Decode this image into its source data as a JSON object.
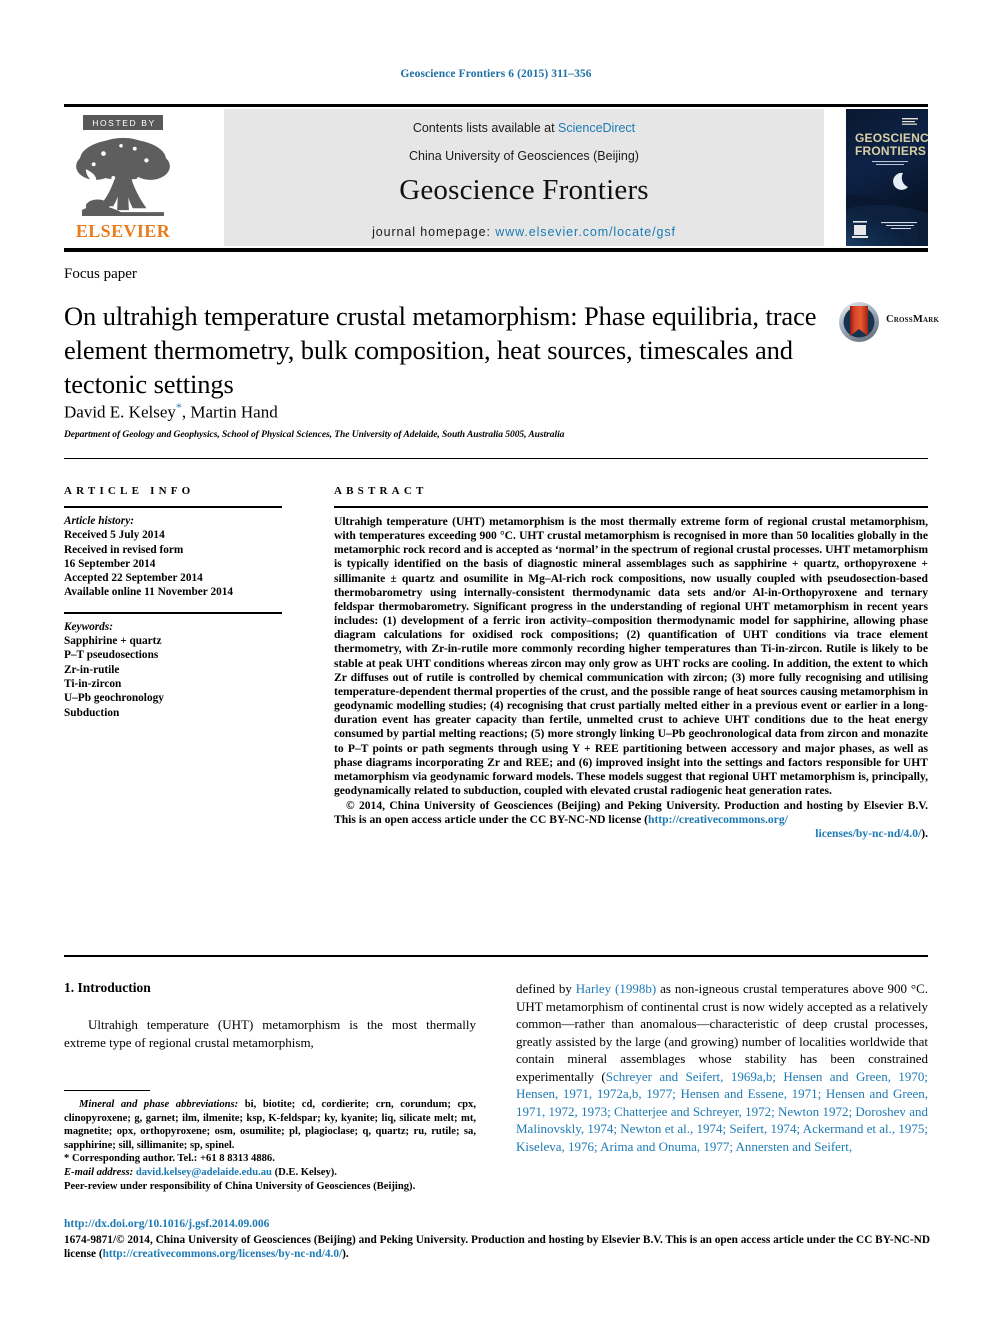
{
  "running_head": "Geoscience Frontiers 6 (2015) 311–356",
  "masthead": {
    "hosted_by": "HOSTED BY",
    "publisher_word": "ELSEVIER",
    "contents_prefix": "Contents lists available at ",
    "contents_link": "ScienceDirect",
    "society": "China University of Geosciences (Beijing)",
    "journal_title": "Geoscience Frontiers",
    "homepage_prefix": "journal homepage: ",
    "homepage_link": "www.elsevier.com/locate/gsf",
    "cover_title_line1": "GEOSCIENCE",
    "cover_title_line2": "FRONTIERS",
    "link_color": "#1d7ab5",
    "panel_color": "#e6e6e6",
    "elsevier_orange": "#e87d1e"
  },
  "title_block": {
    "category": "Focus paper",
    "title": "On ultrahigh temperature crustal metamorphism: Phase equilibria, trace element thermometry, bulk composition, heat sources, timescales and tectonic settings",
    "authors": "David E. Kelsey",
    "authors_tail": ", Martin Hand",
    "corresponding_marker": "*",
    "affiliation": "Department of Geology and Geophysics, School of Physical Sciences, The University of Adelaide, South Australia 5005, Australia",
    "crossmark_label": "CrossMark"
  },
  "article_info": {
    "heading": "ARTICLE INFO",
    "history_label": "Article history:",
    "history": [
      "Received 5 July 2014",
      "Received in revised form",
      "16 September 2014",
      "Accepted 22 September 2014",
      "Available online 11 November 2014"
    ],
    "keywords_label": "Keywords:",
    "keywords": [
      "Sapphirine + quartz",
      "P–T pseudosections",
      "Zr-in-rutile",
      "Ti-in-zircon",
      "U–Pb geochronology",
      "Subduction"
    ]
  },
  "abstract": {
    "heading": "ABSTRACT",
    "body": "Ultrahigh temperature (UHT) metamorphism is the most thermally extreme form of regional crustal metamorphism, with temperatures exceeding 900 °C. UHT crustal metamorphism is recognised in more than 50 localities globally in the metamorphic rock record and is accepted as ‘normal’ in the spectrum of regional crustal processes. UHT metamorphism is typically identified on the basis of diagnostic mineral assemblages such as sapphirine + quartz, orthopyroxene + sillimanite ± quartz and osumilite in Mg–Al-rich rock compositions, now usually coupled with pseudosection-based thermobarometry using internally-consistent thermodynamic data sets and/or Al-in-Orthopyroxene and ternary feldspar thermobarometry. Significant progress in the understanding of regional UHT metamorphism in recent years includes: (1) development of a ferric iron activity–composition thermodynamic model for sapphirine, allowing phase diagram calculations for oxidised rock compositions; (2) quantification of UHT conditions via trace element thermometry, with Zr-in-rutile more commonly recording higher temperatures than Ti-in-zircon. Rutile is likely to be stable at peak UHT conditions whereas zircon may only grow as UHT rocks are cooling. In addition, the extent to which Zr diffuses out of rutile is controlled by chemical communication with zircon; (3) more fully recognising and utilising temperature-dependent thermal properties of the crust, and the possible range of heat sources causing metamorphism in geodynamic modelling studies; (4) recognising that crust partially melted either in a previous event or earlier in a long-duration event has greater capacity than fertile, unmelted crust to achieve UHT conditions due to the heat energy consumed by partial melting reactions; (5) more strongly linking U–Pb geochronological data from zircon and monazite to P–T points or path segments through using Y + REE partitioning between accessory and major phases, as well as phase diagrams incorporating Zr and REE; and (6) improved insight into the settings and factors responsible for UHT metamorphism via geodynamic forward models. These models suggest that regional UHT metamorphism is, principally, geodynamically related to subduction, coupled with elevated crustal radiogenic heat generation rates.",
    "copyright": "© 2014, China University of Geosciences (Beijing) and Peking University. Production and hosting by Elsevier B.V. This is an open access article under the CC BY-NC-ND license (",
    "copyright_link": "http://creativecommons.org/",
    "copyright_link_tail": "licenses/by-nc-nd/4.0/",
    "copyright_close": ")."
  },
  "body": {
    "section_heading": "1. Introduction",
    "left_para": "Ultrahigh temperature (UHT) metamorphism is the most thermally extreme type of regional crustal metamorphism,",
    "right_para_1": "defined by ",
    "right_link_1": "Harley (1998b)",
    "right_para_2": " as non-igneous crustal temperatures above 900 °C. UHT metamorphism of continental crust is now widely accepted as a relatively common—rather than anomalous—characteristic of deep crustal processes, greatly assisted by the large (and growing) number of localities worldwide that contain mineral assemblages whose stability has been constrained experimentally (",
    "right_link_2": "Schreyer and Seifert, 1969a,b; Hensen and Green, 1970; Hensen, 1971, 1972a,b, 1977; Hensen and Essene, 1971; Hensen and Green, 1971, 1972, 1973; Chatterjee and Schreyer, 1972; Newton 1972; Doroshev and Malinovskly, 1974; Newton et al., 1974; Seifert, 1974; Ackermand et al., 1975; Kiseleva, 1976; Arima and Onuma, 1977; Annersten and Seifert,"
  },
  "footnotes": {
    "abbrev_label": "Mineral and phase abbreviations:",
    "abbrev_text": " bi, biotite; cd, cordierite; crn, corundum; cpx, clinopyroxene; g, garnet; ilm, ilmenite; ksp, K-feldspar; ky, kyanite; liq, silicate melt; mt, magnetite; opx, orthopyroxene; osm, osumilite; pl, plagioclase; q, quartz; ru, rutile; sa, sapphirine; sill, sillimanite; sp, spinel.",
    "corresponding": "* Corresponding author. Tel.: +61 8 8313 4886.",
    "email_label": "E-mail address:",
    "email_link": "david.kelsey@adelaide.edu.au",
    "email_tail": " (D.E. Kelsey).",
    "peer_review": "Peer-review under responsibility of China University of Geosciences (Beijing)."
  },
  "bottom": {
    "doi": "http://dx.doi.org/10.1016/j.gsf.2014.09.006",
    "issn_text": "1674-9871/© 2014, China University of Geosciences (Beijing) and Peking University. Production and hosting by Elsevier B.V. This is an open access article under the CC BY-NC-ND license (",
    "issn_link": "http://creativecommons.org/licenses/by-nc-nd/4.0/",
    "issn_close": ")."
  }
}
